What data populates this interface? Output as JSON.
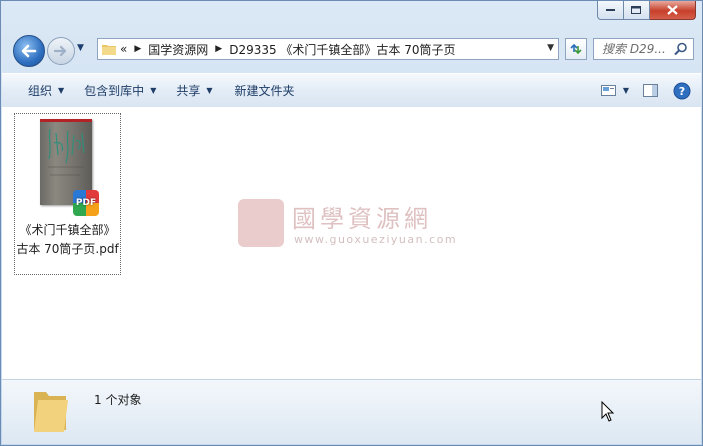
{
  "window": {
    "controls": {
      "minimize_icon": "minimize-icon",
      "maximize_icon": "maximize-icon",
      "close_icon": "close-icon"
    }
  },
  "address_bar": {
    "overflow": "«",
    "crumbs": [
      "国学资源网",
      "D29335 《术门千镇全部》古本 70筒子页"
    ]
  },
  "search": {
    "placeholder": "搜索 D29..."
  },
  "toolbar": {
    "organize": "组织",
    "include_in_library": "包含到库中",
    "share": "共享",
    "new_folder": "新建文件夹"
  },
  "file": {
    "name": "《术门千镇全部》古本 70筒子页.pdf",
    "badge": "PDF"
  },
  "watermark": {
    "title": "國學資源網",
    "url": "www.guoxueziyuan.com"
  },
  "details": {
    "count_text": "1 个对象"
  },
  "colors": {
    "accent": "#2f6fc0",
    "toolbar_text": "#1e3d67",
    "close_red": "#c7402b"
  }
}
